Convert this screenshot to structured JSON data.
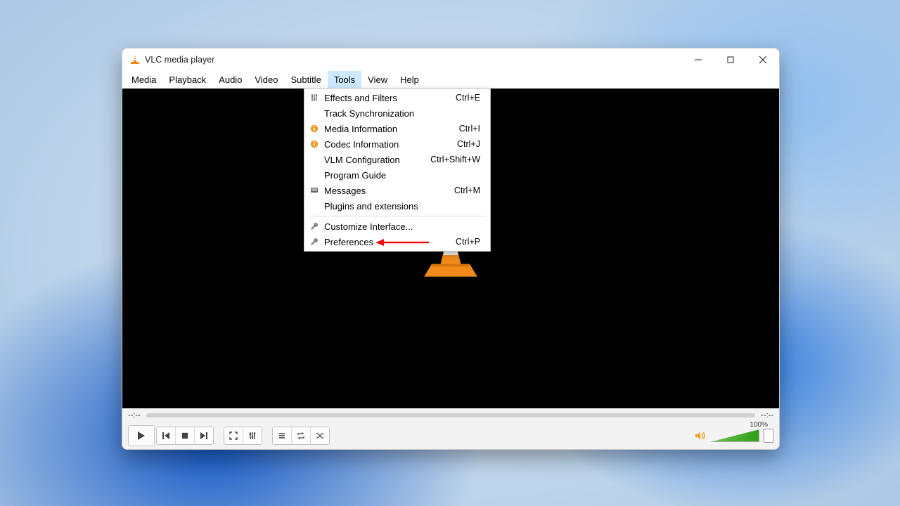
{
  "window": {
    "title": "VLC media player"
  },
  "menubar": [
    "Media",
    "Playback",
    "Audio",
    "Video",
    "Subtitle",
    "Tools",
    "View",
    "Help"
  ],
  "tools_menu": [
    {
      "icon": "sliders",
      "label": "Effects and Filters",
      "shortcut": "Ctrl+E"
    },
    {
      "icon": "",
      "label": "Track Synchronization",
      "shortcut": ""
    },
    {
      "icon": "info",
      "label": "Media Information",
      "shortcut": "Ctrl+I"
    },
    {
      "icon": "info",
      "label": "Codec Information",
      "shortcut": "Ctrl+J"
    },
    {
      "icon": "",
      "label": "VLM Configuration",
      "shortcut": "Ctrl+Shift+W"
    },
    {
      "icon": "",
      "label": "Program Guide",
      "shortcut": ""
    },
    {
      "icon": "messages",
      "label": "Messages",
      "shortcut": "Ctrl+M"
    },
    {
      "icon": "",
      "label": "Plugins and extensions",
      "shortcut": ""
    },
    {
      "sep": true
    },
    {
      "icon": "wrench",
      "label": "Customize Interface...",
      "shortcut": ""
    },
    {
      "icon": "wrench",
      "label": "Preferences",
      "shortcut": "Ctrl+P"
    }
  ],
  "time": {
    "elapsed": "--:--",
    "total": "--:--"
  },
  "volume": {
    "percent_label": "100%"
  }
}
